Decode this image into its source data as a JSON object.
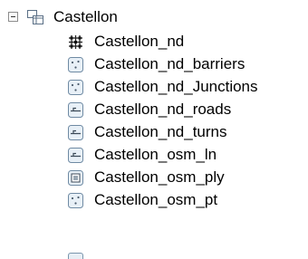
{
  "tree": {
    "root": {
      "label": "Castellon",
      "icon": "group-layer-icon",
      "expanded": true
    },
    "children": [
      {
        "label": "Castellon_nd",
        "icon": "network-dataset-icon"
      },
      {
        "label": "Castellon_nd_barriers",
        "icon": "point-feature-class-icon"
      },
      {
        "label": "Castellon_nd_Junctions",
        "icon": "point-feature-class-icon"
      },
      {
        "label": "Castellon_nd_roads",
        "icon": "line-feature-class-icon"
      },
      {
        "label": "Castellon_nd_turns",
        "icon": "line-feature-class-icon"
      },
      {
        "label": "Castellon_osm_ln",
        "icon": "line-feature-class-icon"
      },
      {
        "label": "Castellon_osm_ply",
        "icon": "polygon-feature-class-icon"
      },
      {
        "label": "Castellon_osm_pt",
        "icon": "point-feature-class-icon"
      }
    ]
  }
}
